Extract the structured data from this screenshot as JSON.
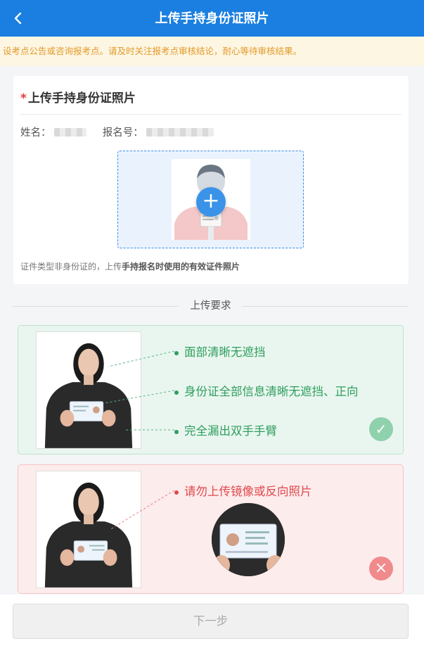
{
  "header": {
    "title": "上传手持身份证照片",
    "back_icon": "chevron-left-icon"
  },
  "notice": {
    "text": "设考点公告或咨询报考点。请及时关注报考点审核结论，耐心等待审核结果。"
  },
  "card": {
    "required_mark": "*",
    "title": "上传手持身份证照片",
    "name_label": "姓名：",
    "reg_label": "报名号：",
    "upload_icon": "plus-icon",
    "hint_prefix": "证件类型非身份证的，上传",
    "hint_bold": "手持报名时使用的有效证件照片"
  },
  "requirements": {
    "title": "上传要求",
    "good": {
      "items": [
        "面部清晰无遮挡",
        "身份证全部信息清晰无遮挡、正向",
        "完全漏出双手手臂"
      ],
      "badge_icon": "check-icon",
      "color": "#2f9e5e"
    },
    "bad": {
      "items": [
        "请勿上传镜像或反向照片"
      ],
      "badge_icon": "close-icon",
      "color": "#e0484c"
    }
  },
  "footer": {
    "next_label": "下一步"
  },
  "colors": {
    "primary": "#1a7fe0",
    "notice_bg": "#fdf6e3",
    "notice_text": "#e39a2a"
  }
}
